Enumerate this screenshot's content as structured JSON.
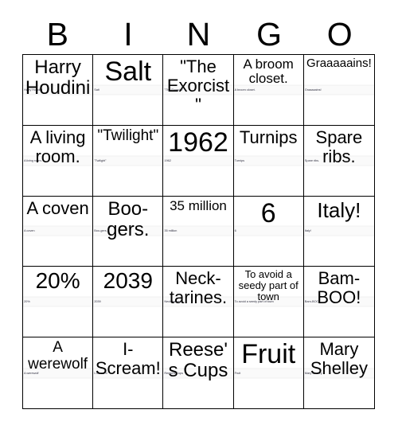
{
  "header": {
    "letters": [
      "B",
      "I",
      "N",
      "G",
      "O"
    ]
  },
  "grid": {
    "rows": 5,
    "columns": 5,
    "cells": [
      {
        "text": "Harry Houdini",
        "micro": "Harry Houdini"
      },
      {
        "text": "Salt",
        "micro": "Salt"
      },
      {
        "text": "\"The Exorcist\"",
        "micro": "\"The Exorcist\""
      },
      {
        "text": "A broom closet.",
        "micro": "A broom closet."
      },
      {
        "text": "Graaaaains!",
        "micro": "Graaaaains!"
      },
      {
        "text": "A living room.",
        "micro": "A living room."
      },
      {
        "text": "\"Twilight\"",
        "micro": "\"Twilight\""
      },
      {
        "text": "1962",
        "micro": "1962"
      },
      {
        "text": "Turnips",
        "micro": "Turnips"
      },
      {
        "text": "Spare ribs.",
        "micro": "Spare ribs."
      },
      {
        "text": "A coven",
        "micro": "A coven"
      },
      {
        "text": "Boo-gers.",
        "micro": "Boo-gers."
      },
      {
        "text": "35 million",
        "micro": "35 million"
      },
      {
        "text": "6",
        "micro": "6"
      },
      {
        "text": "Italy!",
        "micro": "Italy!"
      },
      {
        "text": "20%",
        "micro": "20%"
      },
      {
        "text": "2039",
        "micro": "2039"
      },
      {
        "text": "Neck-tarines.",
        "micro": "Neck-tarines."
      },
      {
        "text": "To avoid a seedy part of town",
        "micro": "To avoid a seedy part of town"
      },
      {
        "text": "Bam-BOO!",
        "micro": "Bam-BOO!"
      },
      {
        "text": "A werewolf",
        "micro": "A werewolf"
      },
      {
        "text": "I-Scream!",
        "micro": "I-Scream!"
      },
      {
        "text": "Reese's Cups",
        "micro": "Reese's Cups"
      },
      {
        "text": "Fruit",
        "micro": "Fruit"
      },
      {
        "text": "Mary Shelley",
        "micro": "Mary Shelley"
      }
    ]
  },
  "colors": {
    "background": "#ffffff",
    "grid_line": "#000000",
    "text": "#000000",
    "band": "#fafafa",
    "micro_text": "#3a3a4a"
  }
}
